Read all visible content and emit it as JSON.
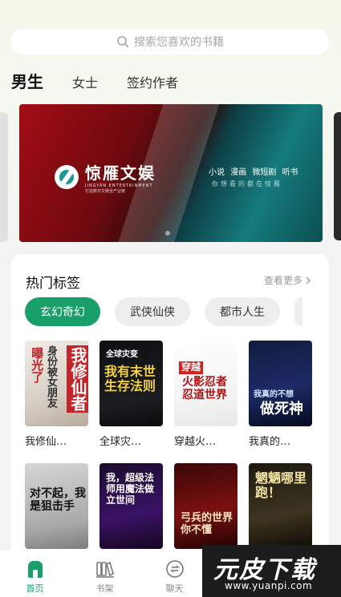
{
  "search": {
    "placeholder": "搜索您喜欢的书籍"
  },
  "tabs": [
    "男生",
    "女士",
    "签约作者"
  ],
  "banner": {
    "brand": "惊雁文娱",
    "brand_en": "JINGYAN ENTERTAINMENT",
    "brand_sub": "打造数字文娱全产业链",
    "genres": "小说 漫画 微短剧 听书",
    "slogan": "你想看的都在惊雁"
  },
  "hot_tags": {
    "title": "热门标签",
    "more": "查看更多",
    "tags": [
      "玄幻奇幻",
      "武侠仙侠",
      "都市人生"
    ]
  },
  "books_row1": [
    {
      "title": "我修仙…",
      "cover_text": "我修仙者",
      "cover_sub": "曝光了",
      "cover_extra": "身份被女朋友"
    },
    {
      "title": "全球灾…",
      "cover_text": "我有末世生存法则",
      "cover_sub": "全球灾变"
    },
    {
      "title": "穿越火…",
      "cover_text": "火影忍者忍道世界",
      "cover_sub": "穿越"
    },
    {
      "title": "我真的…",
      "cover_text": "做死神",
      "cover_sub": "我真的不想"
    }
  ],
  "books_row2": [
    {
      "cover_text": "对不起，我是狙击手"
    },
    {
      "cover_text": "我，超级法师用魔法做立世间"
    },
    {
      "cover_text": "弓兵的世界你不懂"
    },
    {
      "cover_text": "魍魉哪里跑！"
    }
  ],
  "bottom_nav": [
    {
      "label": "首页",
      "icon": "home-icon"
    },
    {
      "label": "书架",
      "icon": "bookshelf-icon"
    },
    {
      "label": "聊天",
      "icon": "chat-icon"
    }
  ],
  "watermark": {
    "text": "元皮下载",
    "url": "www.yuanpi.com"
  },
  "colors": {
    "accent": "#19a06a"
  }
}
